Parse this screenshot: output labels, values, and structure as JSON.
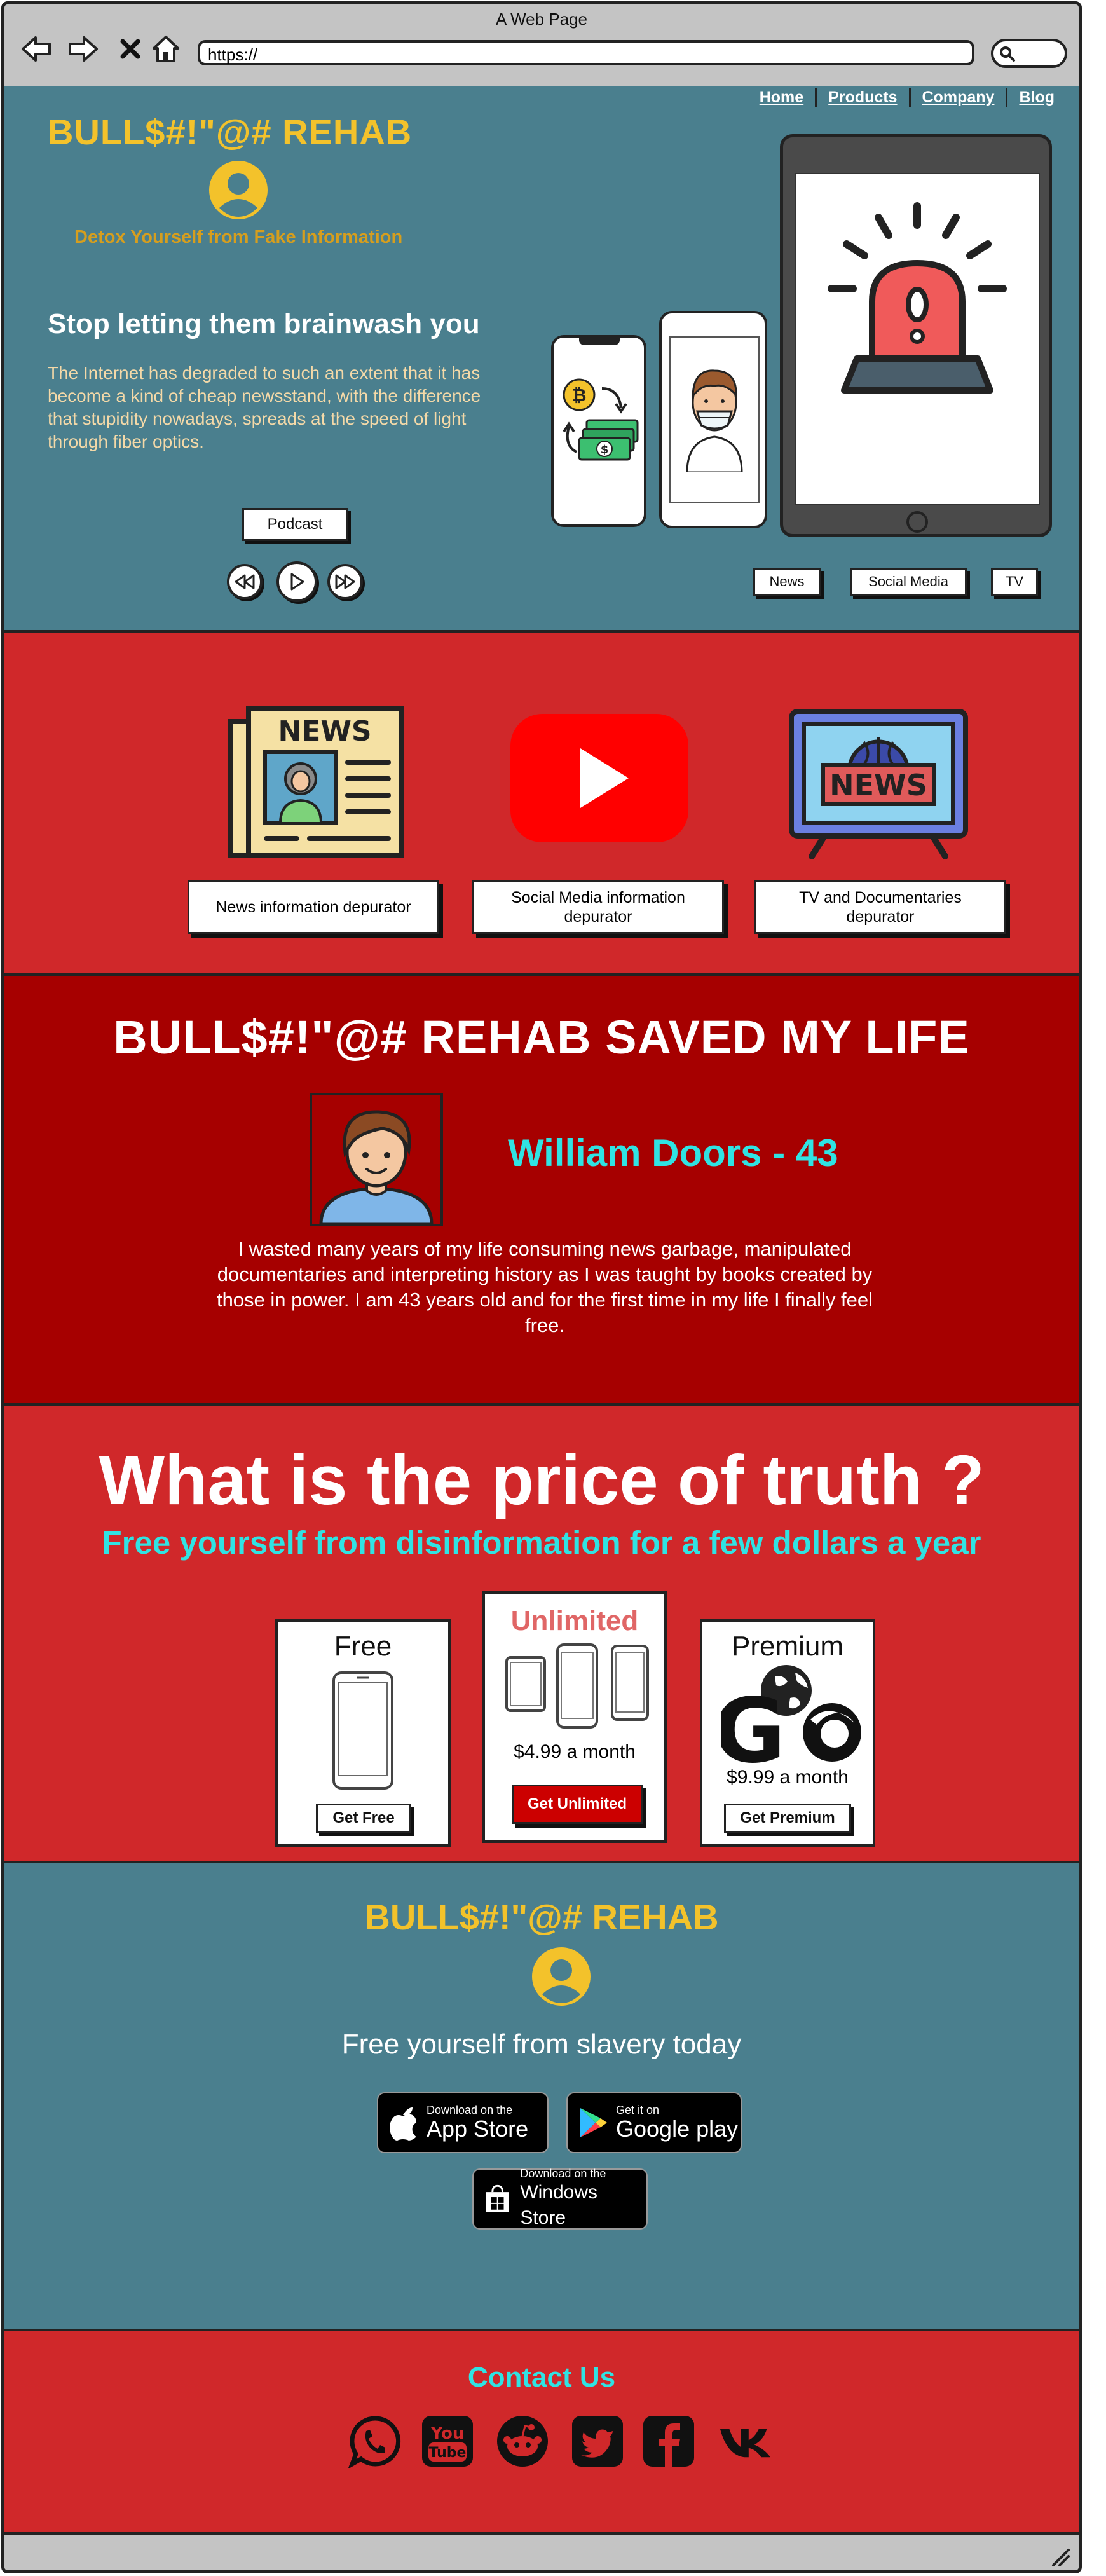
{
  "browser": {
    "window_title": "A Web Page",
    "url": "https://"
  },
  "nav": {
    "links": [
      "Home",
      "Products",
      "Company",
      "Blog"
    ]
  },
  "hero": {
    "brand": "BULL$#!\"@# REHAB",
    "tagline": "Detox Yourself from Fake Information",
    "headline": "Stop letting them brainwash you",
    "paragraph": "The Internet has degraded to such an extent that it has become a kind of cheap newsstand, with the difference that stupidity nowadays, spreads at the speed of light through fiber optics.",
    "podcast_label": "Podcast",
    "filters": [
      "News",
      "Social Media",
      "TV"
    ]
  },
  "services": {
    "items": [
      {
        "label": "News information depurator",
        "icon": "newspaper-icon"
      },
      {
        "label": "Social Media information depurator",
        "icon": "youtube-icon"
      },
      {
        "label": "TV and Documentaries depurator",
        "icon": "tv-news-icon"
      }
    ]
  },
  "testimonial": {
    "heading": "BULL$#!\"@# REHAB SAVED MY LIFE",
    "name": "William Doors - 43",
    "quote": "I wasted many years of my life consuming news garbage, manipulated documentaries and interpreting history as I was taught by books created by those in power.  I am 43 years old and for the first time in my life I finally feel free."
  },
  "pricing": {
    "heading": "What is the price of truth ?",
    "subheading": "Free yourself from disinformation for a few dollars a year",
    "plans": [
      {
        "title": "Free",
        "price": "",
        "button": "Get Free"
      },
      {
        "title": "Unlimited",
        "price": "$4.99 a month",
        "button": "Get Unlimited"
      },
      {
        "title": "Premium",
        "price": "$9.99 a month",
        "button": "Get Premium"
      }
    ]
  },
  "apps": {
    "brand": "BULL$#!\"@# REHAB",
    "headline": "Free yourself from slavery today",
    "stores": [
      {
        "small": "Download on the",
        "large": "App Store"
      },
      {
        "small": "Get it on",
        "large": "Google play"
      },
      {
        "small": "Download on the",
        "large": "Windows Store"
      }
    ]
  },
  "contact": {
    "heading": "Contact Us",
    "icons": [
      "whatsapp-icon",
      "youtube-icon",
      "reddit-icon",
      "twitter-icon",
      "facebook-icon",
      "vk-icon"
    ]
  },
  "colors": {
    "teal": "#4a7f8e",
    "red": "#d0282a",
    "dark_red": "#a60000",
    "gold": "#f3c22b",
    "cyan": "#30e3e3"
  }
}
